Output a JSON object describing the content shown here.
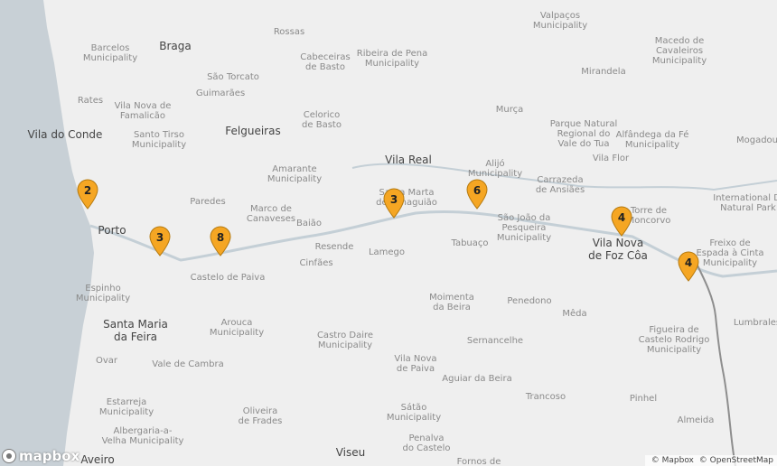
{
  "map": {
    "colors": {
      "land": "#efefef",
      "ocean": "#c8d0d6",
      "river": "#c4cfd6",
      "border": "#8e8e8e",
      "marker": "#f5a623"
    },
    "labels": [
      {
        "text": "Braga",
        "kind": "city"
      },
      {
        "text": "Rossas",
        "kind": "place"
      },
      {
        "text": "Valpaços\nMunicipality",
        "kind": "place"
      },
      {
        "text": "Barcelos\nMunicipality",
        "kind": "place"
      },
      {
        "text": "Cabeceiras\nde Basto",
        "kind": "place"
      },
      {
        "text": "Ribeira de Pena\nMunicipality",
        "kind": "place"
      },
      {
        "text": "Macedo de\nCavaleiros\nMunicipality",
        "kind": "place"
      },
      {
        "text": "São Torcato",
        "kind": "place"
      },
      {
        "text": "Mirandela",
        "kind": "place"
      },
      {
        "text": "Guimarães",
        "kind": "place"
      },
      {
        "text": "Rates",
        "kind": "place"
      },
      {
        "text": "Vila Nova de\nFamalicão",
        "kind": "place"
      },
      {
        "text": "Murça",
        "kind": "place"
      },
      {
        "text": "Celorico\nde Basto",
        "kind": "place"
      },
      {
        "text": "Parque Natural\nRegional do\nVale do Tua",
        "kind": "place"
      },
      {
        "text": "Vila do Conde",
        "kind": "city"
      },
      {
        "text": "Felgueiras",
        "kind": "city"
      },
      {
        "text": "Santo Tirso\nMunicipality",
        "kind": "place"
      },
      {
        "text": "Alfândega da Fé\nMunicipality",
        "kind": "place"
      },
      {
        "text": "Mogadou",
        "kind": "place"
      },
      {
        "text": "Vila Real",
        "kind": "city"
      },
      {
        "text": "Vila Flor",
        "kind": "place"
      },
      {
        "text": "Amarante\nMunicipality",
        "kind": "place"
      },
      {
        "text": "Alijó\nMunicipality",
        "kind": "place"
      },
      {
        "text": "Carrazeda\nde Ansiães",
        "kind": "place"
      },
      {
        "text": "Paredes",
        "kind": "place"
      },
      {
        "text": "Santa Marta\nde Penaguião",
        "kind": "place"
      },
      {
        "text": "International Di\nNatural Park",
        "kind": "place"
      },
      {
        "text": "Marco de\nCanaveses",
        "kind": "place"
      },
      {
        "text": "Torre de\nMoncorvo",
        "kind": "place"
      },
      {
        "text": "Porto",
        "kind": "city"
      },
      {
        "text": "Baião",
        "kind": "place"
      },
      {
        "text": "São João da\nPesqueira\nMunicipality",
        "kind": "place"
      },
      {
        "text": "Tabuaço",
        "kind": "place"
      },
      {
        "text": "Vila Nova\nde Foz Côa",
        "kind": "city"
      },
      {
        "text": "Freixo de\nEspada à Cinta\nMunicipality",
        "kind": "place"
      },
      {
        "text": "Resende",
        "kind": "place"
      },
      {
        "text": "Lamego",
        "kind": "place"
      },
      {
        "text": "Cinfães",
        "kind": "place"
      },
      {
        "text": "Castelo de Paiva",
        "kind": "place"
      },
      {
        "text": "Espinho\nMunicipality",
        "kind": "place"
      },
      {
        "text": "Moimenta\nda Beira",
        "kind": "place"
      },
      {
        "text": "Penedono",
        "kind": "place"
      },
      {
        "text": "Mêda",
        "kind": "place"
      },
      {
        "text": "Lumbrales",
        "kind": "place"
      },
      {
        "text": "Santa Maria\nda Feira",
        "kind": "city"
      },
      {
        "text": "Arouca\nMunicipality",
        "kind": "place"
      },
      {
        "text": "Castro Daire\nMunicipality",
        "kind": "place"
      },
      {
        "text": "Sernancelhe",
        "kind": "place"
      },
      {
        "text": "Figueira de\nCastelo Rodrigo\nMunicipality",
        "kind": "place"
      },
      {
        "text": "Ovar",
        "kind": "place"
      },
      {
        "text": "Vale de Cambra",
        "kind": "place"
      },
      {
        "text": "Vila Nova\nde Paiva",
        "kind": "place"
      },
      {
        "text": "Aguiar da Beira",
        "kind": "place"
      },
      {
        "text": "Trancoso",
        "kind": "place"
      },
      {
        "text": "Pinhel",
        "kind": "place"
      },
      {
        "text": "Estarreja\nMunicipality",
        "kind": "place"
      },
      {
        "text": "Oliveira\nde Frades",
        "kind": "place"
      },
      {
        "text": "Sátão\nMunicipality",
        "kind": "place"
      },
      {
        "text": "Almeida",
        "kind": "place"
      },
      {
        "text": "Albergaria-a-\nVelha Municipality",
        "kind": "place"
      },
      {
        "text": "Penalva\ndo Castelo",
        "kind": "place"
      },
      {
        "text": "Viseu",
        "kind": "city"
      },
      {
        "text": "Aveiro",
        "kind": "city"
      },
      {
        "text": "Fornos de",
        "kind": "place"
      }
    ],
    "markers": [
      {
        "count": "2",
        "name": "cluster-marker-vila-do-conde"
      },
      {
        "count": "3",
        "name": "cluster-marker-porto-south"
      },
      {
        "count": "8",
        "name": "cluster-marker-castelo-de-paiva"
      },
      {
        "count": "3",
        "name": "cluster-marker-santa-marta"
      },
      {
        "count": "6",
        "name": "cluster-marker-alijo"
      },
      {
        "count": "4",
        "name": "cluster-marker-vila-nova-de-foz-coa"
      },
      {
        "count": "4",
        "name": "cluster-marker-freixo"
      }
    ],
    "logo_text": "mapbox",
    "attribution": [
      "© Mapbox",
      "© OpenStreetMap"
    ]
  }
}
